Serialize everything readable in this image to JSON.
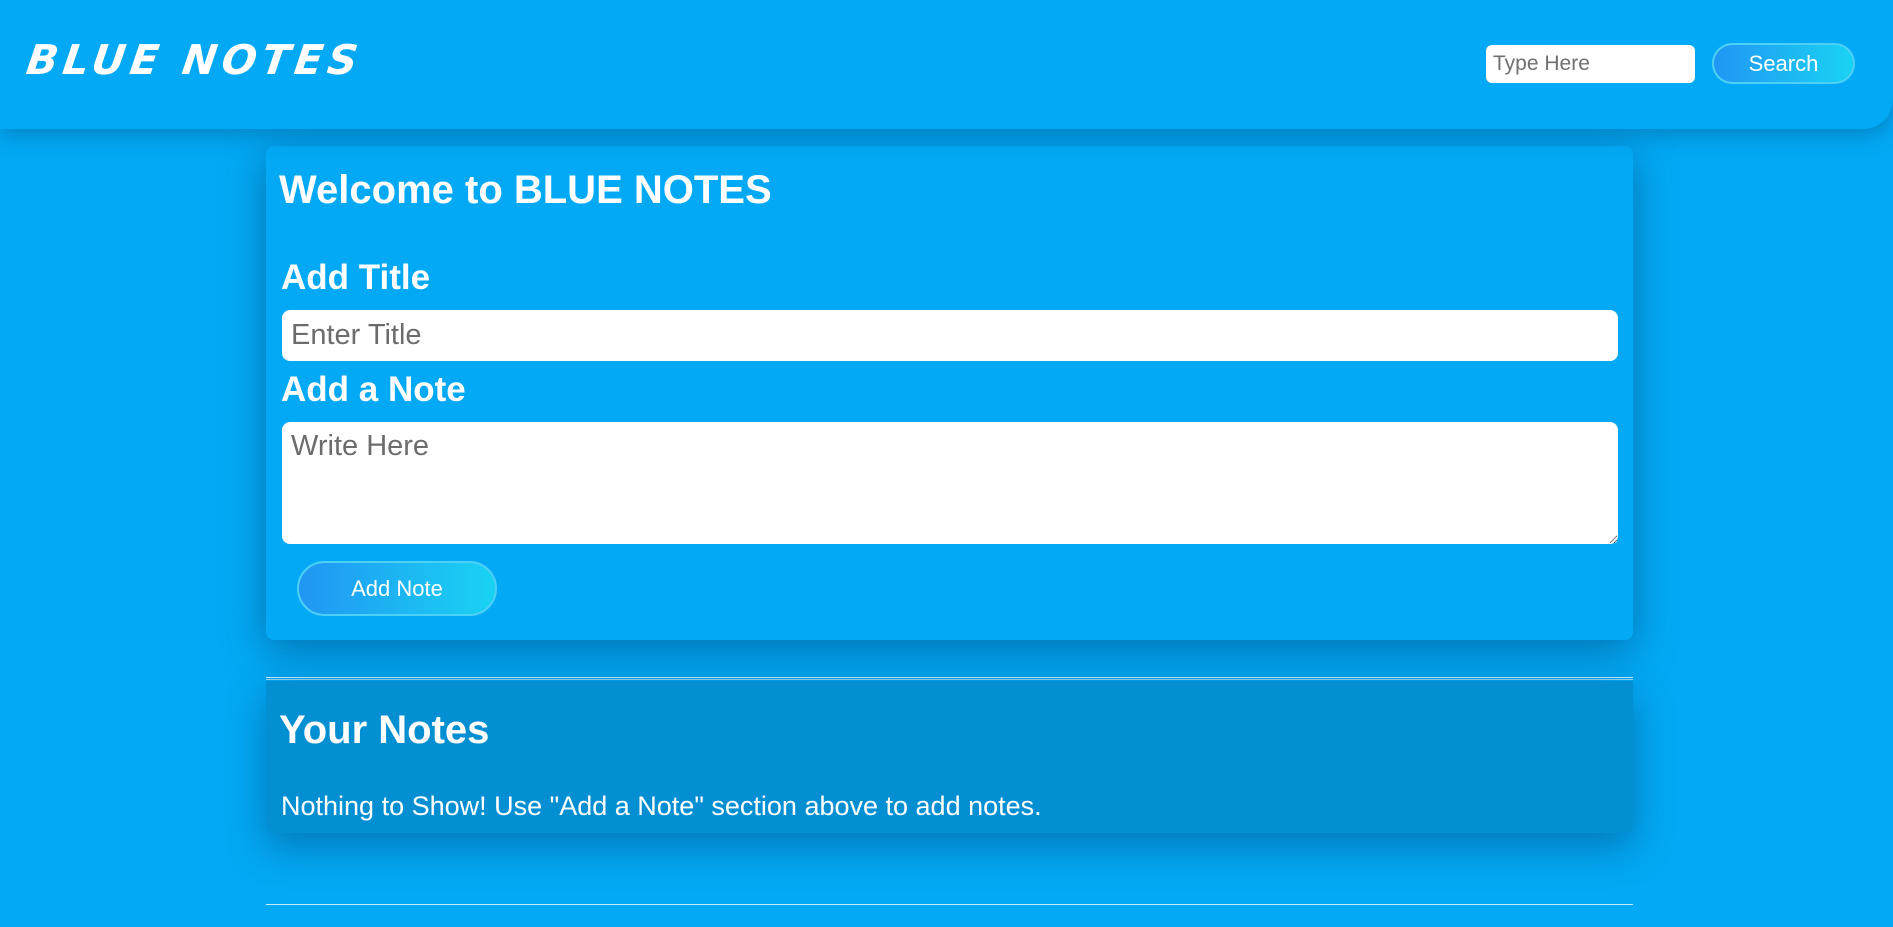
{
  "navbar": {
    "brand": "BLUE NOTES",
    "search_placeholder": "Type Here",
    "search_button": "Search"
  },
  "add_section": {
    "heading": "Welcome to BLUE NOTES",
    "title_label": "Add Title",
    "title_placeholder": "Enter Title",
    "note_label": "Add a Note",
    "note_placeholder": "Write Here",
    "add_button": "Add Note"
  },
  "notes_section": {
    "heading": "Your Notes",
    "empty_message": "Nothing to Show! Use \"Add a Note\" section above to add notes."
  },
  "colors": {
    "background": "#03a9f4",
    "button_gradient_start": "#2196f3",
    "button_gradient_end": "#19d3f3",
    "text": "#ffffff"
  }
}
